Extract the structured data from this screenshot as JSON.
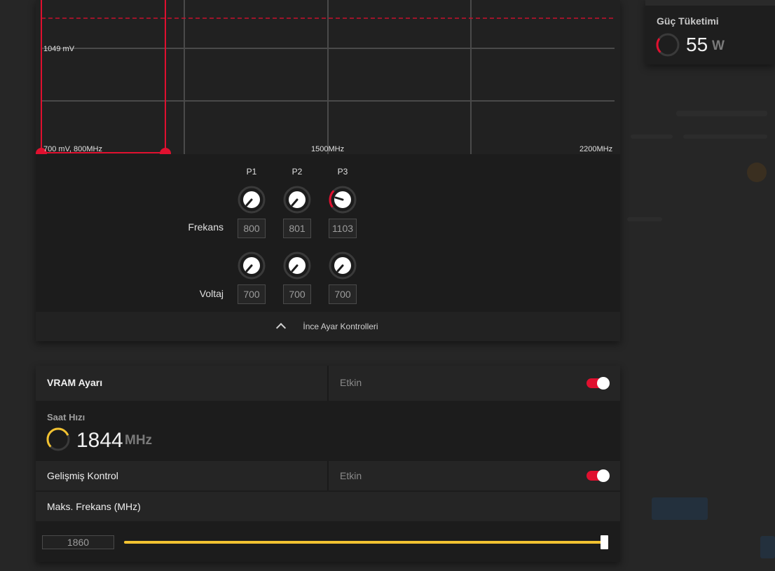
{
  "chart": {
    "label_voltage": "1049 mV",
    "label_origin": "700 mV, 800MHz",
    "label_mid": "1500MHz",
    "label_max": "2200MHz"
  },
  "tuning": {
    "columns": [
      "P1",
      "P2",
      "P3"
    ],
    "frequency_label": "Frekans",
    "voltage_label": "Voltaj",
    "frequency_values": [
      "800",
      "801",
      "1103"
    ],
    "voltage_values": [
      "700",
      "700",
      "700"
    ],
    "fine_tune_label": "İnce Ayar Kontrolleri"
  },
  "power": {
    "title": "Güç Tüketimi",
    "value": "55",
    "unit": "W",
    "gauge_fraction": 0.3
  },
  "vram": {
    "title": "VRAM Ayarı",
    "status": "Etkin",
    "clock_label": "Saat Hızı",
    "clock_value": "1844",
    "clock_unit": "MHz",
    "clock_gauge_fraction": 0.75,
    "advanced_title": "Gelişmiş Kontrol",
    "advanced_status": "Etkin",
    "max_freq_title": "Maks. Frekans (MHz)",
    "max_freq_value": "1860",
    "max_freq_fraction": 1.0
  },
  "colors": {
    "accent_red": "#e0102f",
    "accent_yellow": "#f2c231"
  }
}
